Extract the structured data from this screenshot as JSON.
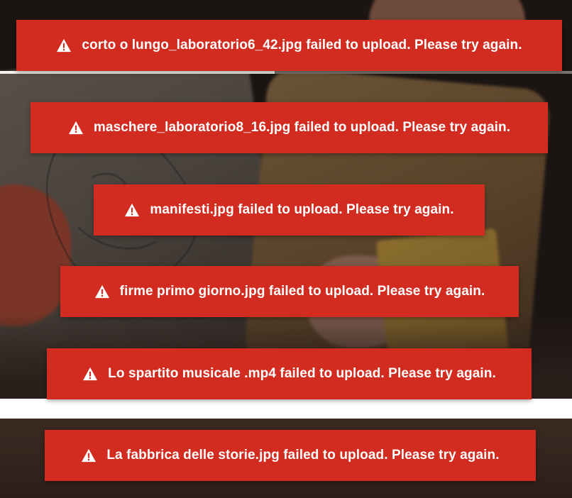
{
  "toasts": [
    {
      "message": "corto o lungo_laboratorio6_42.jpg failed to upload. Please try again.",
      "icon": "warning-icon"
    },
    {
      "message": "maschere_laboratorio8_16.jpg failed to upload. Please try again.",
      "icon": "warning-icon"
    },
    {
      "message": "manifesti.jpg failed to upload. Please try again.",
      "icon": "warning-icon"
    },
    {
      "message": "firme primo giorno.jpg failed to upload. Please try again.",
      "icon": "warning-icon"
    },
    {
      "message": "Lo spartito musicale .mp4 failed to upload. Please try again.",
      "icon": "warning-icon"
    },
    {
      "message": "La fabbrica delle storie.jpg failed to upload. Please try again.",
      "icon": "warning-icon"
    }
  ],
  "upload_progress": 0.48,
  "colors": {
    "toast_background": "#d12c1f",
    "toast_text": "#ffffff"
  }
}
